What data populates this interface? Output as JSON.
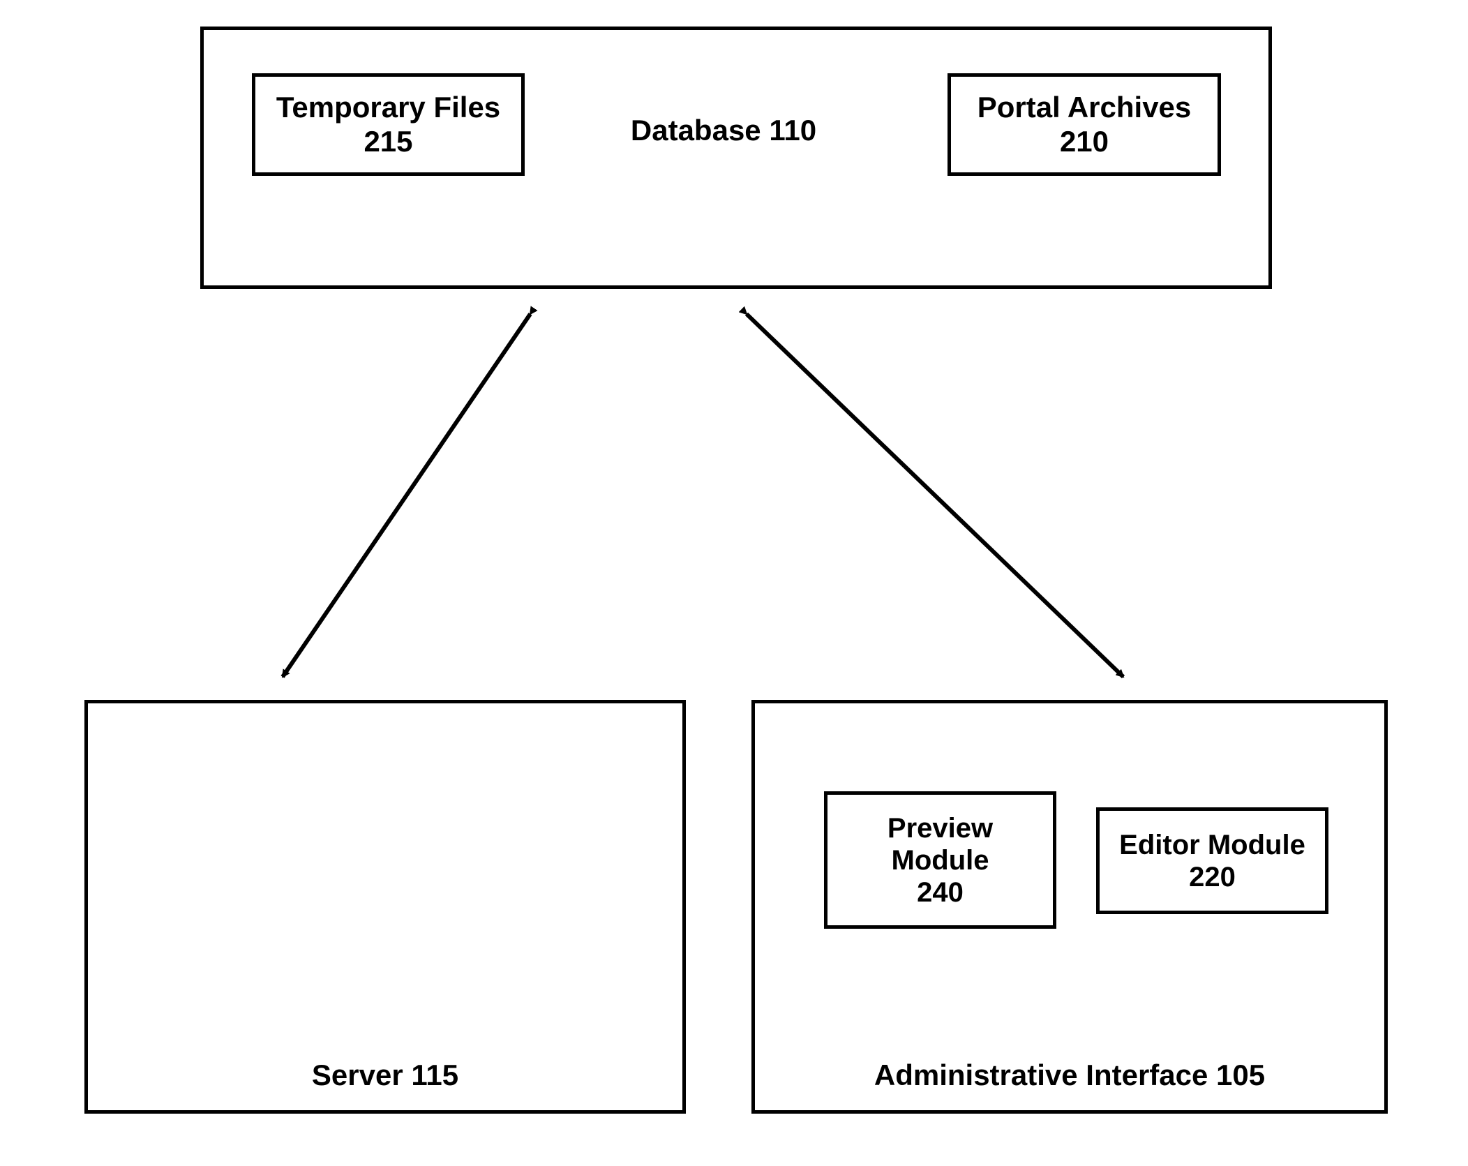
{
  "database": {
    "label": "Database 110",
    "temporary_files": {
      "line1": "Temporary Files",
      "line2": "215"
    },
    "portal_archives": {
      "line1": "Portal Archives",
      "line2": "210"
    }
  },
  "server": {
    "label": "Server 115"
  },
  "admin": {
    "label": "Administrative Interface 105",
    "preview_module": {
      "line1": "Preview",
      "line2": "Module",
      "line3": "240"
    },
    "editor_module": {
      "line1": "Editor Module",
      "line2": "220"
    }
  }
}
